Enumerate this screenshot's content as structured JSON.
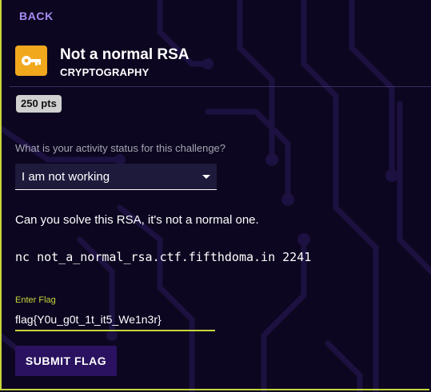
{
  "nav": {
    "back_label": "BACK"
  },
  "challenge": {
    "icon": "key-icon",
    "title": "Not a normal RSA",
    "category": "CRYPTOGRAPHY",
    "points": "250 pts",
    "description": "Can you solve this RSA, it's not a normal one.",
    "command": "nc not_a_normal_rsa.ctf.fifthdoma.in 2241"
  },
  "status": {
    "question": "What is your activity status for this challenge?",
    "selected": "I am not working"
  },
  "flag": {
    "label": "Enter Flag",
    "value": "flag{Y0u_g0t_1t_it5_We1n3r}",
    "submit_label": "SUBMIT FLAG"
  },
  "colors": {
    "background": "#0c0620",
    "accent": "#c8d53a",
    "link": "#a78cf5",
    "icon_bg": "#f2a81d",
    "button": "#2a1260"
  }
}
